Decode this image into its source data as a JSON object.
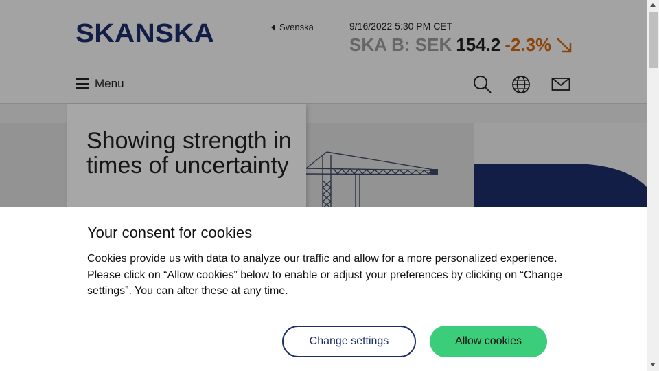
{
  "brand": {
    "logo": "SKANSKA",
    "color": "#1d2e6b"
  },
  "header": {
    "language_label": "Svenska",
    "menu_label": "Menu",
    "stock": {
      "datetime": "9/16/2022 5:30 PM CET",
      "label": "SKA B: SEK",
      "price": "154.2",
      "change": "-2.3%",
      "change_color": "#d06810",
      "trend_icon": "arrow-down-right-icon"
    },
    "icons": [
      "search-icon",
      "globe-icon",
      "mail-icon"
    ]
  },
  "hero": {
    "title": "Showing strength in times of uncertainty"
  },
  "cookie_banner": {
    "title": "Your consent for cookies",
    "body": "Cookies provide us with data to analyze our traffic and allow for a more personalized experience. Please click on “Allow cookies” below to enable or adjust your preferences by clicking on “Change settings”. You can alter these at any time.",
    "change_settings_label": "Change settings",
    "allow_label": "Allow cookies",
    "allow_color": "#3ccd7a"
  }
}
